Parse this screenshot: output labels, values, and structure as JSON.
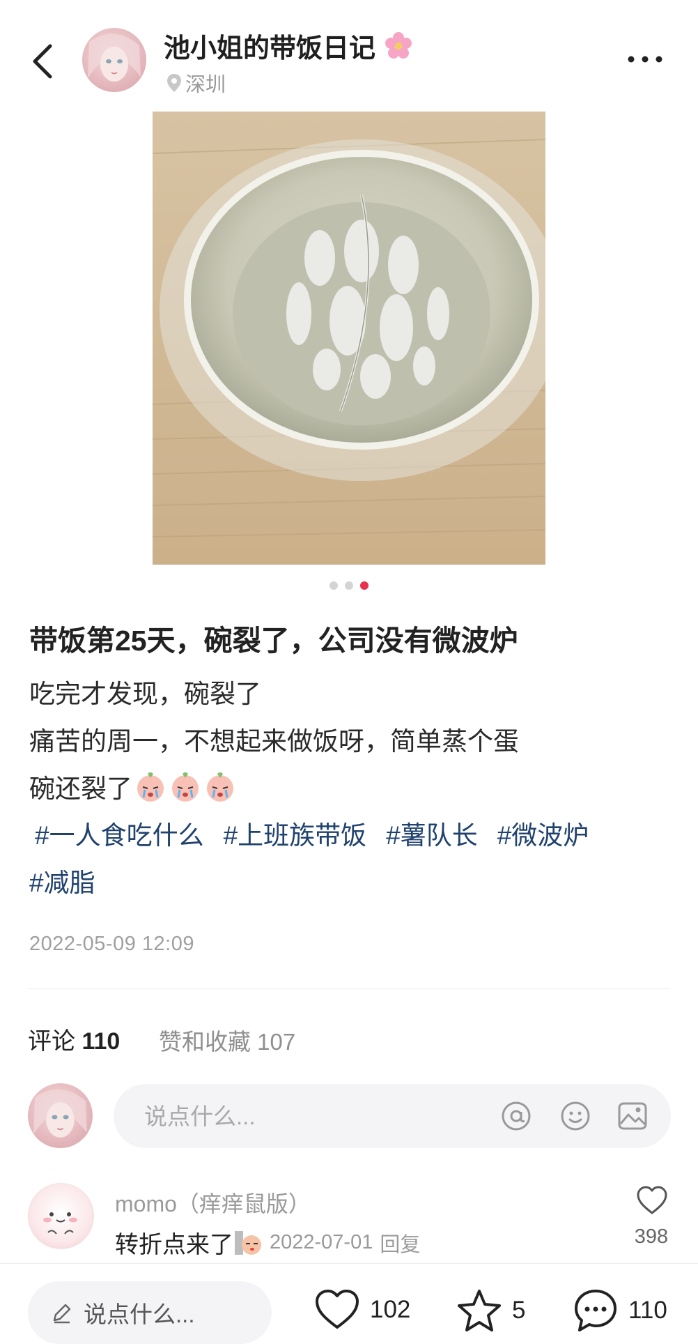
{
  "header": {
    "author_name": "池小姐的带饭日记",
    "location": "深圳"
  },
  "gallery": {
    "image_count": 3,
    "active_index": 3
  },
  "post": {
    "title": "带饭第25天，碗裂了，公司没有微波炉",
    "body_lines": [
      "吃完才发现，碗裂了",
      "痛苦的周一，不想起来做饭呀，简单蒸个蛋",
      "碗还裂了"
    ],
    "tags": [
      "#一人食吃什么",
      "#上班族带饭",
      "#薯队长",
      "#微波炉",
      "#减脂"
    ],
    "date": "2022-05-09 12:09"
  },
  "tabs": {
    "comments_label": "评论",
    "comments_count": "110",
    "likes_label": "赞和收藏 107"
  },
  "comment_input": {
    "placeholder": "说点什么..."
  },
  "comments": [
    {
      "author": "momo（痒痒鼠版）",
      "text": "转折点来了",
      "date": "2022-07-01",
      "reply_label": "回复",
      "likes": "398"
    }
  ],
  "bottom_bar": {
    "input_label": "说点什么...",
    "like_count": "102",
    "collect_count": "5",
    "comment_count": "110"
  },
  "colors": {
    "accent": "#e8314b",
    "tag": "#20426e",
    "muted": "#9a9a9a",
    "input_bg": "#f4f4f6"
  }
}
